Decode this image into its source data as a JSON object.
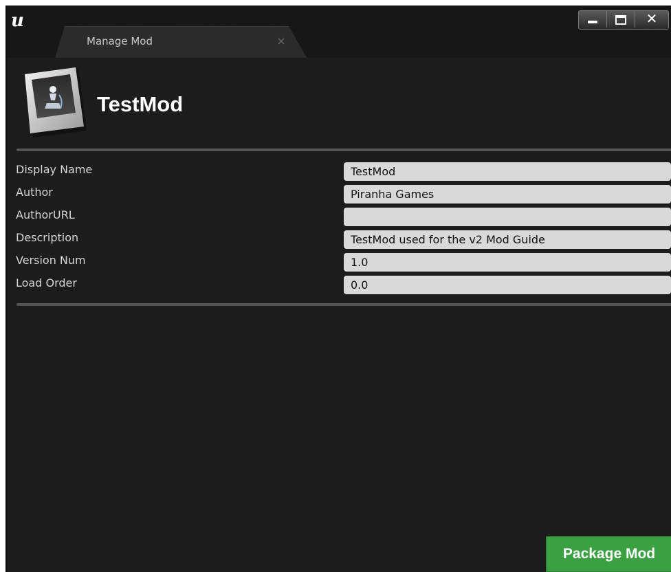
{
  "window": {
    "tab_title": "Manage Mod",
    "tab_close": "×",
    "controls": {
      "close": "✕"
    }
  },
  "mod": {
    "name": "TestMod"
  },
  "properties": [
    {
      "label": "Display Name",
      "value": "TestMod"
    },
    {
      "label": "Author",
      "value": "Piranha Games"
    },
    {
      "label": "AuthorURL",
      "value": ""
    },
    {
      "label": "Description",
      "value": "TestMod used for the v2 Mod Guide"
    },
    {
      "label": "Version Num",
      "value": "1.0"
    },
    {
      "label": "Load Order",
      "value": "0.0"
    }
  ],
  "actions": {
    "package_label": "Package Mod"
  },
  "colors": {
    "background": "#1c1c1c",
    "field": "#d9d9d9",
    "accent_green": "#3aa041"
  }
}
